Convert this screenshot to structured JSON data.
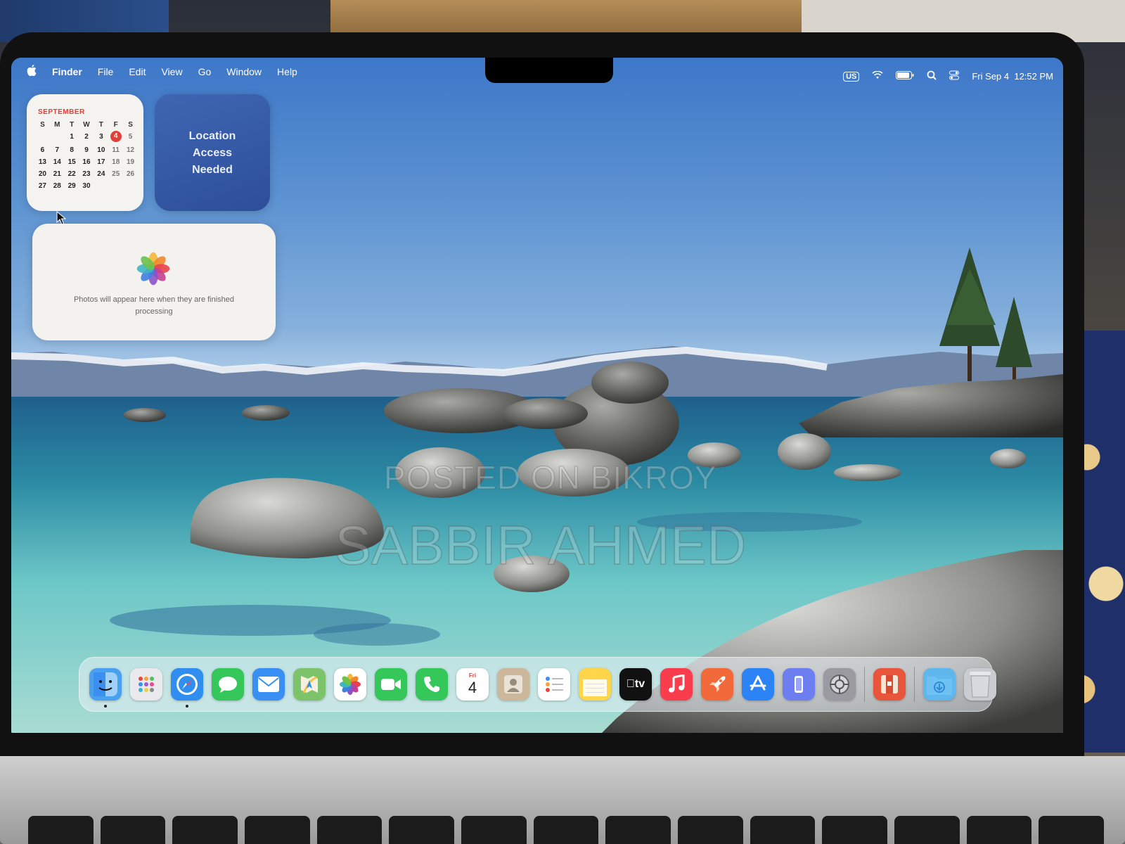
{
  "menubar": {
    "app_name": "Finder",
    "menus": [
      "File",
      "Edit",
      "View",
      "Go",
      "Window",
      "Help"
    ],
    "input_source": "US",
    "date": "Fri Sep 4",
    "time": "12:52 PM"
  },
  "calendar_widget": {
    "month": "SEPTEMBER",
    "weekdays": [
      "S",
      "M",
      "T",
      "W",
      "T",
      "F",
      "S"
    ],
    "first_weekday_index": 2,
    "days_in_month": 30,
    "today": "4"
  },
  "location_widget": {
    "line1": "Location",
    "line2": "Access",
    "line3": "Needed"
  },
  "photos_widget": {
    "message": "Photos will appear here when they are finished processing"
  },
  "watermark": {
    "line1": "POSTED ON BIKROY",
    "line2": "SABBIR AHMED"
  },
  "dock": {
    "apps": [
      {
        "name": "finder-icon",
        "color": "#4aa0f0",
        "running": true
      },
      {
        "name": "launchpad-icon",
        "color": "#e9e9ee",
        "running": false
      },
      {
        "name": "safari-icon",
        "color": "#2f8ef0",
        "running": true
      },
      {
        "name": "messages-icon",
        "color": "#35c759",
        "running": false
      },
      {
        "name": "mail-icon",
        "color": "#3a8ff5",
        "running": false
      },
      {
        "name": "maps-icon",
        "color": "#7cc36a",
        "running": false
      },
      {
        "name": "photos-icon",
        "color": "#ffffff",
        "running": false
      },
      {
        "name": "facetime-icon",
        "color": "#35c759",
        "running": false
      },
      {
        "name": "phone-icon",
        "color": "#35c759",
        "running": false
      },
      {
        "name": "calendar-icon",
        "color": "#ffffff",
        "running": false
      },
      {
        "name": "contacts-icon",
        "color": "#cdb79a",
        "running": false
      },
      {
        "name": "reminders-icon",
        "color": "#ffffff",
        "running": false
      },
      {
        "name": "notes-icon",
        "color": "#ffd54a",
        "running": false
      },
      {
        "name": "tv-icon",
        "color": "#111111",
        "running": false
      },
      {
        "name": "music-icon",
        "color": "#fa3d4c",
        "running": false
      },
      {
        "name": "rocket-icon",
        "color": "#f26a3a",
        "running": false
      },
      {
        "name": "app-store-icon",
        "color": "#2b83f6",
        "running": false
      },
      {
        "name": "iphone-mirroring-icon",
        "color": "#6c7ef0",
        "running": false
      },
      {
        "name": "system-settings-icon",
        "color": "#9a9aa0",
        "running": false
      },
      {
        "name": "separator-1",
        "separator": true
      },
      {
        "name": "archive-utility-icon",
        "color": "#e8553b",
        "running": false
      },
      {
        "name": "separator-2",
        "separator": true
      },
      {
        "name": "downloads-folder-icon",
        "color": "#5fb7ee",
        "running": false
      },
      {
        "name": "trash-icon",
        "color": "#c9cdd2",
        "running": false
      }
    ],
    "calendar_icon_day": "Fri",
    "calendar_icon_date": "4",
    "tv_label": "tv"
  }
}
